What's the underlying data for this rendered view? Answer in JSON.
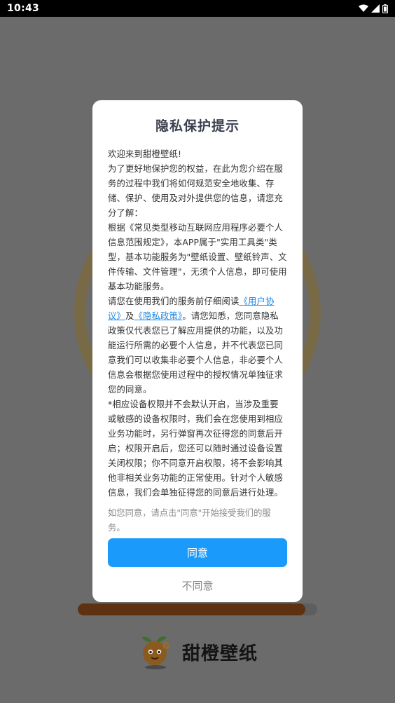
{
  "status_bar": {
    "time": "10:43",
    "icons": [
      "wifi-icon",
      "signal-icon",
      "battery-icon"
    ]
  },
  "splash": {
    "app_name": "甜橙壁纸",
    "logo_icon": "orange-mascot-icon",
    "accent_color": "#5e3210"
  },
  "dialog": {
    "title": "隐私保护提示",
    "paragraphs": {
      "p1": "欢迎来到甜橙壁纸!",
      "p2": "为了更好地保护您的权益，在此为您介绍在服务的过程中我们将如何规范安全地收集、存储、保护、使用及对外提供您的信息，请您充分了解：",
      "p3": "根据《常见类型移动互联网应用程序必要个人信息范围规定》，本APP属于\"实用工具类\"类型，基本功能服务为\"壁纸设置、壁纸铃声、文件传输、文件管理\"，无须个人信息，即可使用基本功能服务。",
      "p4_before": "请您在使用我们的服务前仔细阅读",
      "p4_link1": "《用户协议》",
      "p4_mid": "及",
      "p4_link2": "《隐私政策》",
      "p4_after": "。请您知悉，您同意隐私政策仅代表您已了解应用提供的功能，以及功能运行所需的必要个人信息，并不代表您已同意我们可以收集非必要个人信息，非必要个人信息会根据您使用过程中的授权情况单独征求您的同意。",
      "p5": "*相应设备权限并不会默认开启，当涉及重要或敏感的设备权限时，我们会在您使用到相应业务功能时，另行弹窗再次征得您的同意后开启；权限开启后，您还可以随时通过设备设置关闭权限；你不同意开启权限，将不会影响其他非相关业务功能的正常使用。针对个人敏感信息，我们会单独征得您的同意后进行处理。"
    },
    "note": "如您同意，请点击\"同意\"开始接受我们的服务。",
    "agree_label": "同意",
    "disagree_label": "不同意",
    "accent_color": "#1a9bfc"
  }
}
